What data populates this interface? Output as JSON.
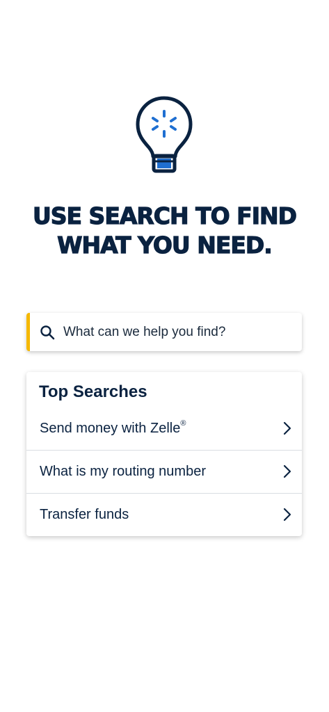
{
  "hero": {
    "icon": "lightbulb-icon",
    "headline_line1": "USE SEARCH TO FIND",
    "headline_line2": "WHAT YOU NEED."
  },
  "search": {
    "icon": "search-icon",
    "placeholder": "What can we help you find?",
    "accent_color": "#f5b800"
  },
  "top_searches": {
    "title": "Top Searches",
    "items": [
      {
        "label": "Send money with Zelle",
        "mark": "®"
      },
      {
        "label": "What is my routing number",
        "mark": ""
      },
      {
        "label": "Transfer funds",
        "mark": ""
      }
    ]
  },
  "colors": {
    "navy": "#0a2240",
    "bulb_blue": "#1f6fd1",
    "accent_yellow": "#f5b800"
  }
}
